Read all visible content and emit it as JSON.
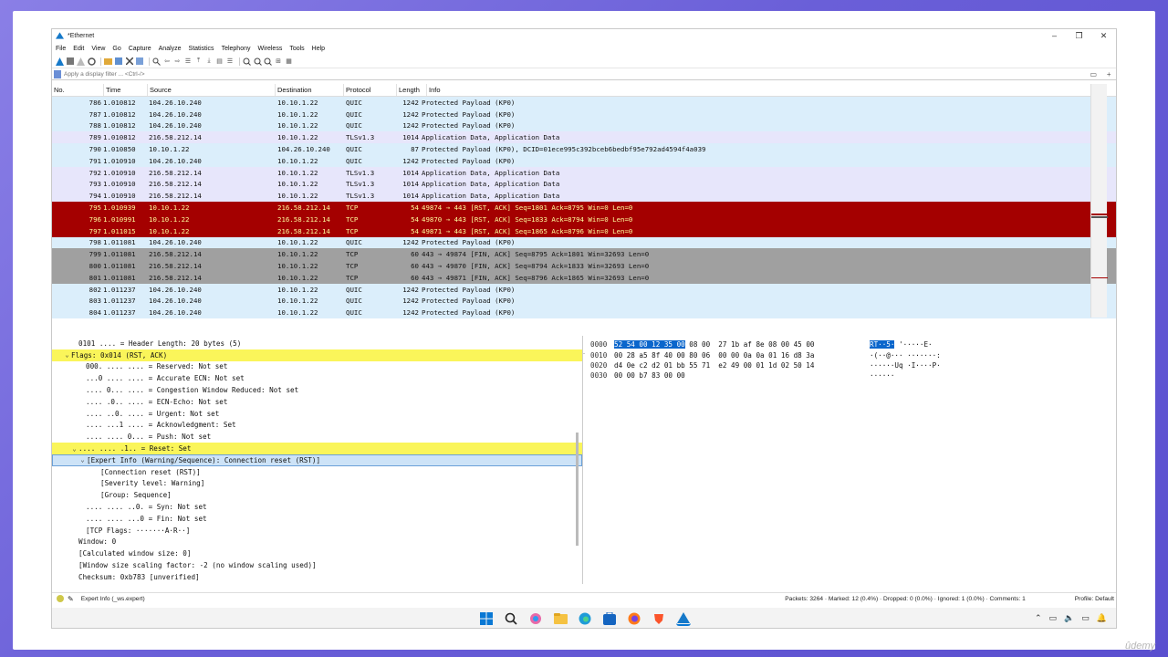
{
  "window": {
    "title": "*Ethernet",
    "controls": [
      "–",
      "❐",
      "✕"
    ]
  },
  "menu": [
    "File",
    "Edit",
    "View",
    "Go",
    "Capture",
    "Analyze",
    "Statistics",
    "Telephony",
    "Wireless",
    "Tools",
    "Help"
  ],
  "filter": {
    "placeholder": "Apply a display filter ... <Ctrl-/>"
  },
  "columns": [
    "No.",
    "Time",
    "Source",
    "Destination",
    "Protocol",
    "Length",
    "Info"
  ],
  "packets": [
    {
      "no": "786",
      "time": "1.010812",
      "src": "104.26.10.240",
      "dst": "10.10.1.22",
      "proto": "QUIC",
      "len": "1242",
      "info": "Protected Payload (KP0)",
      "style": "row-quic"
    },
    {
      "no": "787",
      "time": "1.010812",
      "src": "104.26.10.240",
      "dst": "10.10.1.22",
      "proto": "QUIC",
      "len": "1242",
      "info": "Protected Payload (KP0)",
      "style": "row-quic"
    },
    {
      "no": "788",
      "time": "1.010812",
      "src": "104.26.10.240",
      "dst": "10.10.1.22",
      "proto": "QUIC",
      "len": "1242",
      "info": "Protected Payload (KP0)",
      "style": "row-quic"
    },
    {
      "no": "789",
      "time": "1.010812",
      "src": "216.58.212.14",
      "dst": "10.10.1.22",
      "proto": "TLSv1.3",
      "len": "1014",
      "info": "Application Data, Application Data",
      "style": "row-tls"
    },
    {
      "no": "790",
      "time": "1.010850",
      "src": "10.10.1.22",
      "dst": "104.26.10.240",
      "proto": "QUIC",
      "len": "87",
      "info": "Protected Payload (KP0), DCID=01ece995c392bceb6bedbf95e792ad4594f4a039",
      "style": "row-quic"
    },
    {
      "no": "791",
      "time": "1.010910",
      "src": "104.26.10.240",
      "dst": "10.10.1.22",
      "proto": "QUIC",
      "len": "1242",
      "info": "Protected Payload (KP0)",
      "style": "row-quic"
    },
    {
      "no": "792",
      "time": "1.010910",
      "src": "216.58.212.14",
      "dst": "10.10.1.22",
      "proto": "TLSv1.3",
      "len": "1014",
      "info": "Application Data, Application Data",
      "style": "row-tls"
    },
    {
      "no": "793",
      "time": "1.010910",
      "src": "216.58.212.14",
      "dst": "10.10.1.22",
      "proto": "TLSv1.3",
      "len": "1014",
      "info": "Application Data, Application Data",
      "style": "row-tls"
    },
    {
      "no": "794",
      "time": "1.010910",
      "src": "216.58.212.14",
      "dst": "10.10.1.22",
      "proto": "TLSv1.3",
      "len": "1014",
      "info": "Application Data, Application Data",
      "style": "row-tls"
    },
    {
      "no": "795",
      "time": "1.010939",
      "src": "10.10.1.22",
      "dst": "216.58.212.14",
      "proto": "TCP",
      "len": "54",
      "info": "49874 → 443 [RST, ACK] Seq=1801 Ack=8795 Win=0 Len=0",
      "style": "row-rst"
    },
    {
      "no": "796",
      "time": "1.010991",
      "src": "10.10.1.22",
      "dst": "216.58.212.14",
      "proto": "TCP",
      "len": "54",
      "info": "49870 → 443 [RST, ACK] Seq=1833 Ack=8794 Win=0 Len=0",
      "style": "row-rst"
    },
    {
      "no": "797",
      "time": "1.011015",
      "src": "10.10.1.22",
      "dst": "216.58.212.14",
      "proto": "TCP",
      "len": "54",
      "info": "49871 → 443 [RST, ACK] Seq=1865 Ack=8796 Win=0 Len=0",
      "style": "row-rst"
    },
    {
      "no": "798",
      "time": "1.011081",
      "src": "104.26.10.240",
      "dst": "10.10.1.22",
      "proto": "QUIC",
      "len": "1242",
      "info": "Protected Payload (KP0)",
      "style": "row-quic"
    },
    {
      "no": "799",
      "time": "1.011081",
      "src": "216.58.212.14",
      "dst": "10.10.1.22",
      "proto": "TCP",
      "len": "60",
      "info": "443 → 49874 [FIN, ACK] Seq=8795 Ack=1801 Win=32693 Len=0",
      "style": "row-fin"
    },
    {
      "no": "800",
      "time": "1.011081",
      "src": "216.58.212.14",
      "dst": "10.10.1.22",
      "proto": "TCP",
      "len": "60",
      "info": "443 → 49870 [FIN, ACK] Seq=8794 Ack=1833 Win=32693 Len=0",
      "style": "row-fin"
    },
    {
      "no": "801",
      "time": "1.011081",
      "src": "216.58.212.14",
      "dst": "10.10.1.22",
      "proto": "TCP",
      "len": "60",
      "info": "443 → 49871 [FIN, ACK] Seq=8796 Ack=1865 Win=32693 Len=0",
      "style": "row-fin"
    },
    {
      "no": "802",
      "time": "1.011237",
      "src": "104.26.10.240",
      "dst": "10.10.1.22",
      "proto": "QUIC",
      "len": "1242",
      "info": "Protected Payload (KP0)",
      "style": "row-quic"
    },
    {
      "no": "803",
      "time": "1.011237",
      "src": "104.26.10.240",
      "dst": "10.10.1.22",
      "proto": "QUIC",
      "len": "1242",
      "info": "Protected Payload (KP0)",
      "style": "row-quic"
    },
    {
      "no": "804",
      "time": "1.011237",
      "src": "104.26.10.240",
      "dst": "10.10.1.22",
      "proto": "QUIC",
      "len": "1242",
      "info": "Protected Payload (KP0)",
      "style": "row-quic"
    }
  ],
  "details": [
    {
      "indent": 2,
      "tw": "",
      "text": "0101 .... = Header Length: 20 bytes (5)",
      "style": ""
    },
    {
      "indent": 1,
      "tw": "⌄",
      "text": "Flags: 0x014 (RST, ACK)",
      "style": "hl"
    },
    {
      "indent": 3,
      "tw": "",
      "text": "000. .... .... = Reserved: Not set",
      "style": ""
    },
    {
      "indent": 3,
      "tw": "",
      "text": "...0 .... .... = Accurate ECN: Not set",
      "style": ""
    },
    {
      "indent": 3,
      "tw": "",
      "text": ".... 0... .... = Congestion Window Reduced: Not set",
      "style": ""
    },
    {
      "indent": 3,
      "tw": "",
      "text": ".... .0.. .... = ECN-Echo: Not set",
      "style": ""
    },
    {
      "indent": 3,
      "tw": "",
      "text": ".... ..0. .... = Urgent: Not set",
      "style": ""
    },
    {
      "indent": 3,
      "tw": "",
      "text": ".... ...1 .... = Acknowledgment: Set",
      "style": ""
    },
    {
      "indent": 3,
      "tw": "",
      "text": ".... .... 0... = Push: Not set",
      "style": ""
    },
    {
      "indent": 2,
      "tw": "⌄",
      "text": ".... .... .1.. = Reset: Set",
      "style": "hl"
    },
    {
      "indent": 3,
      "tw": "⌄",
      "text": "[Expert Info (Warning/Sequence): Connection reset (RST)]",
      "style": "sel"
    },
    {
      "indent": 5,
      "tw": "",
      "text": "[Connection reset (RST)]",
      "style": ""
    },
    {
      "indent": 5,
      "tw": "",
      "text": "[Severity level: Warning]",
      "style": ""
    },
    {
      "indent": 5,
      "tw": "",
      "text": "[Group: Sequence]",
      "style": ""
    },
    {
      "indent": 3,
      "tw": "",
      "text": ".... .... ..0. = Syn: Not set",
      "style": ""
    },
    {
      "indent": 3,
      "tw": "",
      "text": ".... .... ...0 = Fin: Not set",
      "style": ""
    },
    {
      "indent": 3,
      "tw": "",
      "text": "[TCP Flags: ·······A·R··]",
      "style": ""
    },
    {
      "indent": 2,
      "tw": "",
      "text": "Window: 0",
      "style": ""
    },
    {
      "indent": 2,
      "tw": "",
      "text": "[Calculated window size: 0]",
      "style": ""
    },
    {
      "indent": 2,
      "tw": "",
      "text": "[Window size scaling factor: -2 (no window scaling used)]",
      "style": ""
    },
    {
      "indent": 2,
      "tw": "",
      "text": "Checksum: 0xb783 [unverified]",
      "style": ""
    }
  ],
  "bytes": [
    {
      "off": "0000",
      "hex_hl": "52 54 00 12 35 00",
      "hex_rest": " 08 00  27 1b af 8e 08 00 45 00",
      "asc_hl": "RT··5·",
      "asc_rest": " '·····E·"
    },
    {
      "off": "0010",
      "hex_hl": "",
      "hex_rest": "00 28 a5 8f 40 00 80 06  00 00 0a 0a 01 16 d8 3a",
      "asc_hl": "",
      "asc_rest": "·(··@··· ·······:"
    },
    {
      "off": "0020",
      "hex_hl": "",
      "hex_rest": "d4 0e c2 d2 01 bb 55 71  e2 49 00 01 1d 02 50 14",
      "asc_hl": "",
      "asc_rest": "······Uq ·I····P·"
    },
    {
      "off": "0030",
      "hex_hl": "",
      "hex_rest": "00 00 b7 83 00 00",
      "asc_hl": "",
      "asc_rest": "······"
    }
  ],
  "status": {
    "expert": "Expert Info (_ws.expert)",
    "stats": "Packets: 3264 · Marked: 12 (0.4%) · Dropped: 0 (0.0%) · Ignored: 1 (0.0%) · Comments: 1",
    "profile": "Profile: Default"
  },
  "watermark": "ûdemy",
  "colors": {
    "quic": "#dbeefb",
    "tls": "#e7e6fb",
    "rst": "#a40000",
    "rst_text": "#fffc9c",
    "fin": "#a0a0a0",
    "highlight": "#faf55a"
  }
}
